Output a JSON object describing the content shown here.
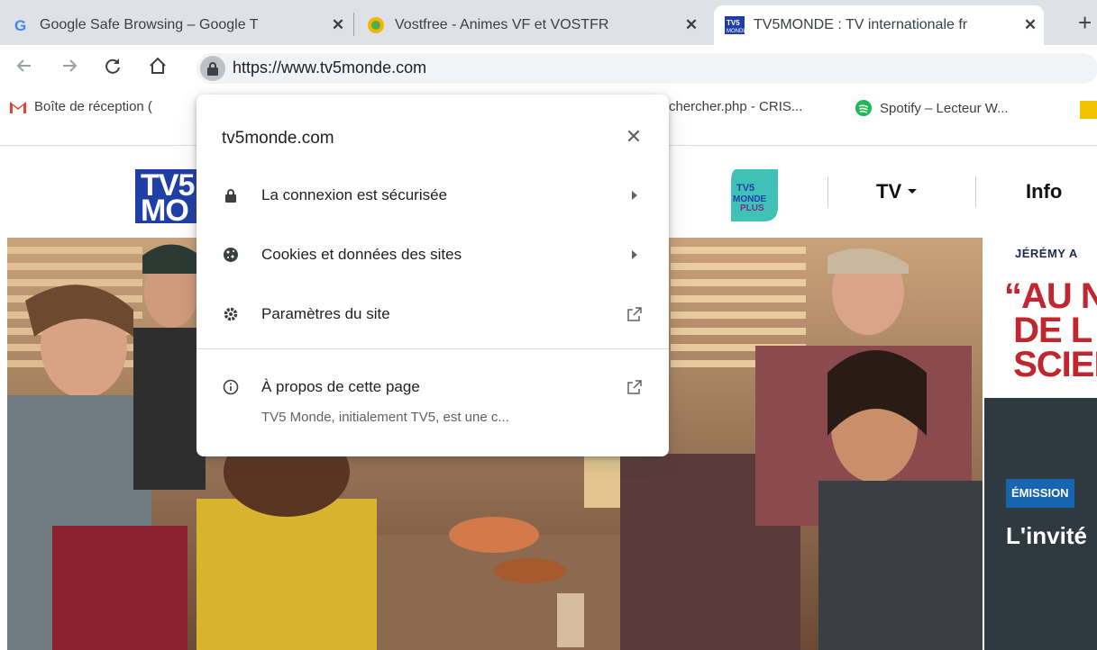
{
  "browser": {
    "tabs": [
      {
        "title": "Google Safe Browsing – Google T",
        "active": false,
        "favicon": "google-g-icon"
      },
      {
        "title": "Vostfree - Animes VF et VOSTFR",
        "active": false,
        "favicon": "vostfree-icon"
      },
      {
        "title": "TV5MONDE : TV internationale fr",
        "active": true,
        "favicon": "tv5monde-icon"
      }
    ],
    "new_tab": "+",
    "close_glyph": "✕",
    "url": "https://www.tv5monde.com",
    "bookmarks": [
      {
        "label": "Boîte de réception (",
        "icon": "gmail-icon"
      },
      {
        "label": "chercher.php - CRIS...",
        "icon": "page-icon"
      },
      {
        "label": "Spotify – Lecteur W...",
        "icon": "spotify-icon"
      }
    ]
  },
  "site_info_popup": {
    "domain": "tv5monde.com",
    "close_glyph": "✕",
    "items": [
      {
        "label": "La connexion est sécurisée",
        "icon": "lock-icon",
        "trailing": "arrow-right-icon"
      },
      {
        "label": "Cookies et données des sites",
        "icon": "cookie-icon",
        "trailing": "arrow-right-icon"
      },
      {
        "label": "Paramètres du site",
        "icon": "gear-icon",
        "trailing": "open-external-icon"
      }
    ],
    "about": {
      "label": "À propos de cette page",
      "description": "TV5 Monde, initialement TV5, est une c...",
      "icon": "info-icon",
      "trailing": "open-external-icon"
    }
  },
  "page": {
    "logo_text": "TV5\nMO",
    "nav": {
      "tv_label": "TV",
      "info_label": "Info"
    },
    "card": {
      "name": "JÉRÉMY A",
      "quote": "“AU N\n DE L\n SCIEN",
      "badge": "ÉMISSION",
      "title": "L'invité"
    }
  },
  "colors": {
    "tabstrip": "#dee1e6",
    "accent_blue": "#1f3fa6",
    "quote_red": "#c0262d",
    "badge_blue": "#1764b0"
  }
}
